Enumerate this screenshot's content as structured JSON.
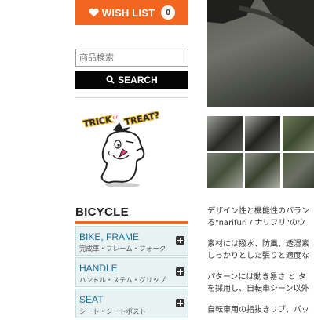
{
  "wishlist": {
    "label": "WISH LIST",
    "count": "0"
  },
  "search": {
    "placeholder": "商品検索",
    "value": "",
    "button_label": "SEARCH"
  },
  "banner": {
    "text": "TRICK or TREAT?"
  },
  "category": {
    "title": "BICYCLE",
    "items": [
      {
        "name": "BIKE, FRAME",
        "sub": "完成車・フレーム・フォーク"
      },
      {
        "name": "HANDLE",
        "sub": "ハンドル・ステム・グリップ"
      },
      {
        "name": "SEAT",
        "sub": "シート・シートポスト"
      }
    ]
  },
  "description": {
    "lines": [
      "デザイン性と機能性のバラン",
      "る\"narifuri / ナリフリ\"のウ",
      "素材には撥水、防風、透湿素",
      "しっかりとした張りと適度な",
      "パターンには動き易さ と タ",
      "を採用し、自転車シーン以外",
      "自転車用の指抜きリブ、バッ"
    ]
  },
  "colors": {
    "accent": "#f2661f",
    "search_button": "#050505",
    "category_bg": "#e8f2f3",
    "link": "#1a6f9a"
  },
  "icons": {
    "wishlist": "heart-icon",
    "search": "magnifier-icon",
    "expand": "plus-square-icon"
  }
}
